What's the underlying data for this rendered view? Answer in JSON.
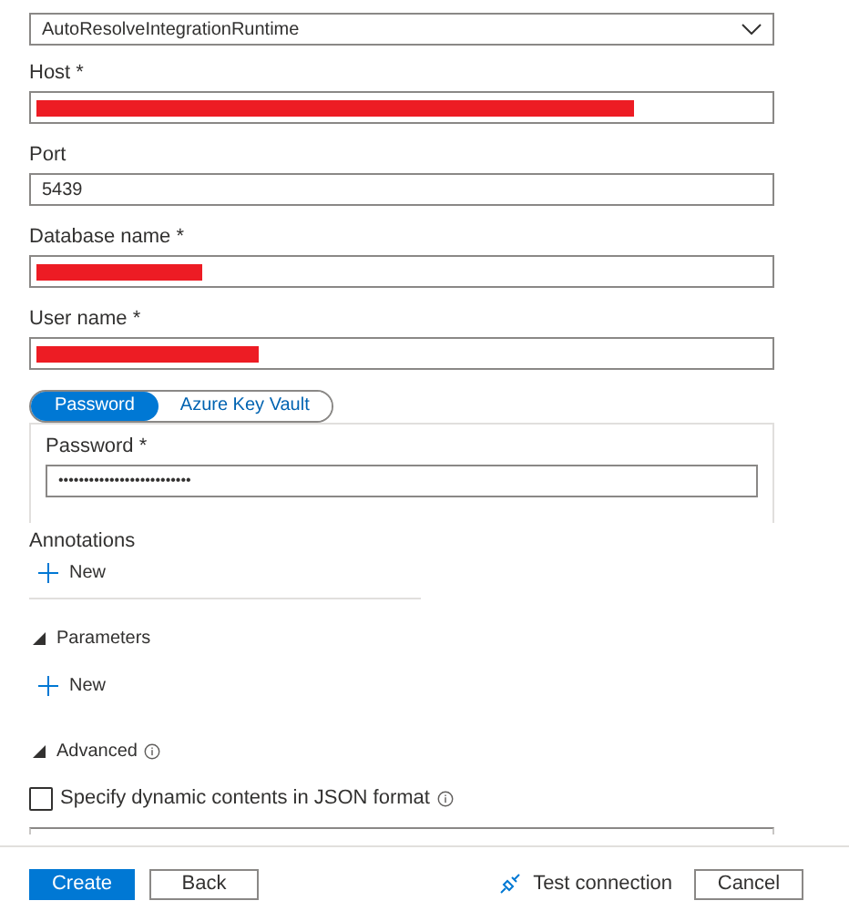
{
  "runtime": {
    "value": "AutoResolveIntegrationRuntime"
  },
  "fields": [
    {
      "label": "Host *",
      "redacted": true,
      "level": 0.83
    },
    {
      "label": "Port",
      "value": "5439"
    },
    {
      "label": "Database name *",
      "redacted": true,
      "level": 0.23
    },
    {
      "label": "User name *",
      "redacted": true,
      "level": 0.31
    }
  ],
  "auth_tabs": [
    {
      "label": "Password",
      "selected": true
    },
    {
      "label": "Azure Key Vault",
      "selected": false
    }
  ],
  "password": {
    "label": "Password *",
    "value": "••••••••••••••••••••••••••"
  },
  "annotations": {
    "title": "Annotations",
    "new": "New"
  },
  "parameters": {
    "title": "Parameters",
    "expanded": true,
    "new": "New"
  },
  "advanced": {
    "title": "Advanced",
    "expanded": true
  },
  "json_option": {
    "label": "Specify dynamic contents in JSON format",
    "checked": false
  },
  "footer": {
    "create": "Create",
    "back": "Back",
    "test": "Test connection",
    "cancel": "Cancel"
  }
}
